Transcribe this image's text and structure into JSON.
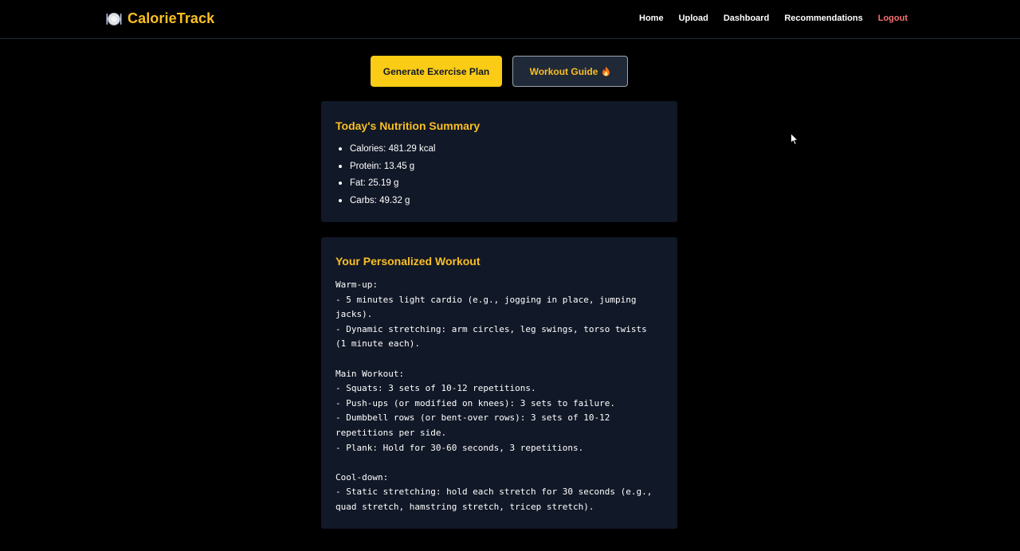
{
  "app": {
    "name": "CalorieTrack",
    "icon": "plate-cutlery-icon",
    "accent_color": "#fbbf24"
  },
  "nav": {
    "links": [
      {
        "label": "Home"
      },
      {
        "label": "Upload"
      },
      {
        "label": "Dashboard"
      },
      {
        "label": "Recommendations"
      },
      {
        "label": "Logout"
      }
    ]
  },
  "actions": {
    "generate_plan_label": "Generate Exercise Plan",
    "workout_guide_label": "Workout Guide",
    "workout_guide_icon": "fire-icon"
  },
  "nutrition": {
    "title": "Today's Nutrition Summary",
    "items": [
      "Calories: 481.29 kcal",
      "Protein: 13.45 g",
      "Fat: 25.19 g",
      "Carbs: 49.32 g"
    ]
  },
  "workout": {
    "title": "Your Personalized Workout",
    "lines": [
      "Warm-up:",
      "- 5 minutes light cardio (e.g., jogging in place, jumping",
      "jacks).",
      "- Dynamic stretching: arm circles, leg swings, torso twists",
      "(1 minute each).",
      "",
      "Main Workout:",
      "- Squats: 3 sets of 10-12 repetitions.",
      "- Push-ups (or modified on knees): 3 sets to failure.",
      "- Dumbbell rows (or bent-over rows): 3 sets of 10-12",
      "repetitions per side.",
      "- Plank: Hold for 30-60 seconds, 3 repetitions.",
      "",
      "Cool-down:",
      "- Static stretching: hold each stretch for 30 seconds (e.g.,",
      "quad stretch, hamstring stretch, tricep stretch)."
    ]
  }
}
